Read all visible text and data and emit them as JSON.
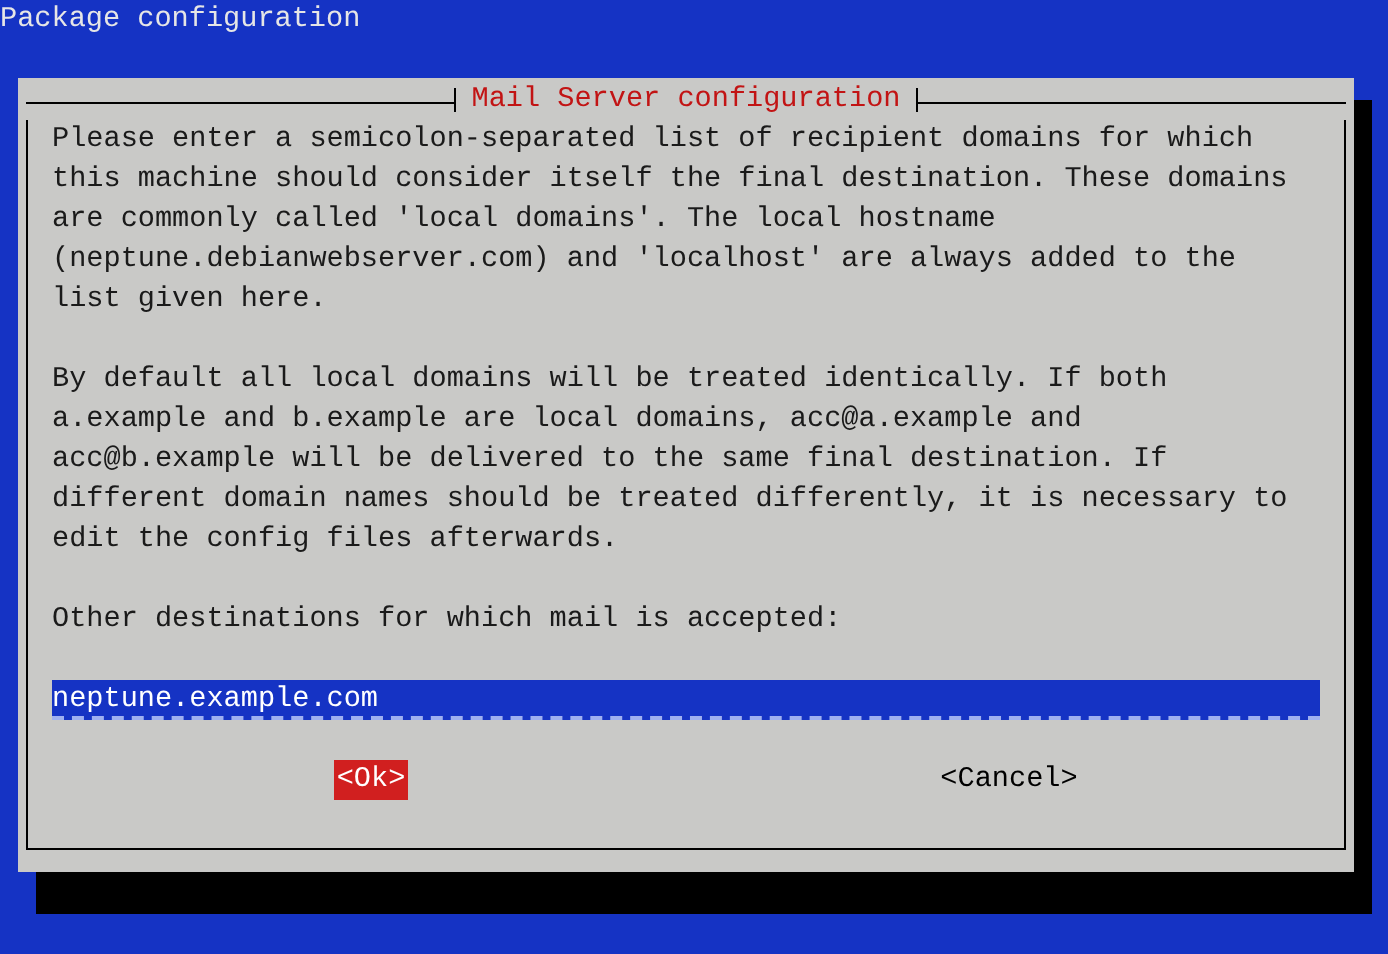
{
  "screen_title": "Package configuration",
  "dialog": {
    "title": "Mail Server configuration",
    "paragraphs": [
      {
        "lines": [
          "Please enter a semicolon-separated list of recipient domains for which",
          "this machine should consider itself the final destination. These domains",
          "are commonly called 'local domains'. The local hostname",
          "(neptune.debianwebserver.com) and 'localhost' are always added to the",
          "list given here."
        ]
      },
      {
        "lines": [
          "By default all local domains will be treated identically. If both",
          "a.example and b.example are local domains, acc@a.example and",
          "acc@b.example will be delivered to the same final destination. If",
          "different domain names should be treated differently, it is necessary to",
          "edit the config files afterwards."
        ]
      }
    ],
    "field_label": "Other destinations for which mail is accepted:",
    "field": {
      "value": "neptune.example.com"
    },
    "buttons": [
      {
        "label": "<Ok>",
        "selected": true
      },
      {
        "label": "<Cancel>",
        "selected": false
      }
    ]
  }
}
